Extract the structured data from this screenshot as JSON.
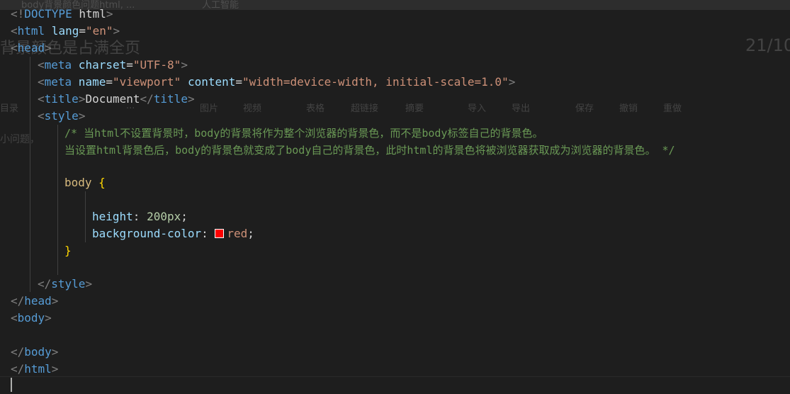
{
  "ghost": {
    "top_tab_text": "body背景颜色问题html, ...",
    "top_tab_text2": "人工智能",
    "heading": "背景颜色是占满全页",
    "page_counter": "21/10",
    "toolbar_items": [
      "目录",
      "...",
      "图片",
      "视频",
      "表格",
      "超链接",
      "摘要",
      "导入",
      "导出",
      "保存",
      "撤销",
      "重做"
    ],
    "body_text": "小问题，"
  },
  "code": {
    "line1": {
      "open": "<!",
      "doctype": "DOCTYPE",
      "html": " html",
      "close": ">"
    },
    "line2": {
      "open": "<",
      "tag": "html",
      "attr": " lang",
      "eq": "=",
      "val": "\"en\"",
      "close": ">"
    },
    "line3": {
      "open": "<",
      "tag": "head",
      "close": ">"
    },
    "line4": {
      "open": "<",
      "tag": "meta",
      "attr": " charset",
      "eq": "=",
      "val": "\"UTF-8\"",
      "close": ">"
    },
    "line5": {
      "open": "<",
      "tag": "meta",
      "attr1": " name",
      "eq1": "=",
      "val1": "\"viewport\"",
      "attr2": " content",
      "eq2": "=",
      "val2": "\"width=device-width, initial-scale=1.0\"",
      "close": ">"
    },
    "line6": {
      "open": "<",
      "tag": "title",
      "close": ">",
      "text": "Document",
      "open2": "</",
      "tag2": "title",
      "close2": ">"
    },
    "line7": {
      "open": "<",
      "tag": "style",
      "close": ">"
    },
    "comment1": "/* 当html不设置背景时，body的背景将作为整个浏览器的背景色，而不是body标签自己的背景色。",
    "comment2": "当设置html背景色后，body的背景色就变成了body自己的背景色，此时html的背景色将被浏览器获取成为浏览器的背景色。 */",
    "selector": "body",
    "brace_open": " {",
    "prop1": "height",
    "colon1": ": ",
    "val1": "200px",
    "semi1": ";",
    "prop2": "background-color",
    "colon2": ": ",
    "val2": "red",
    "semi2": ";",
    "swatch_color": "#ff0000",
    "brace_close": "}",
    "line_style_close": {
      "open": "</",
      "tag": "style",
      "close": ">"
    },
    "line_head_close": {
      "open": "</",
      "tag": "head",
      "close": ">"
    },
    "line_body_open": {
      "open": "<",
      "tag": "body",
      "close": ">"
    },
    "line_body_close": {
      "open": "</",
      "tag": "body",
      "close": ">"
    },
    "line_html_close": {
      "open": "</",
      "tag": "html",
      "close": ">"
    }
  }
}
